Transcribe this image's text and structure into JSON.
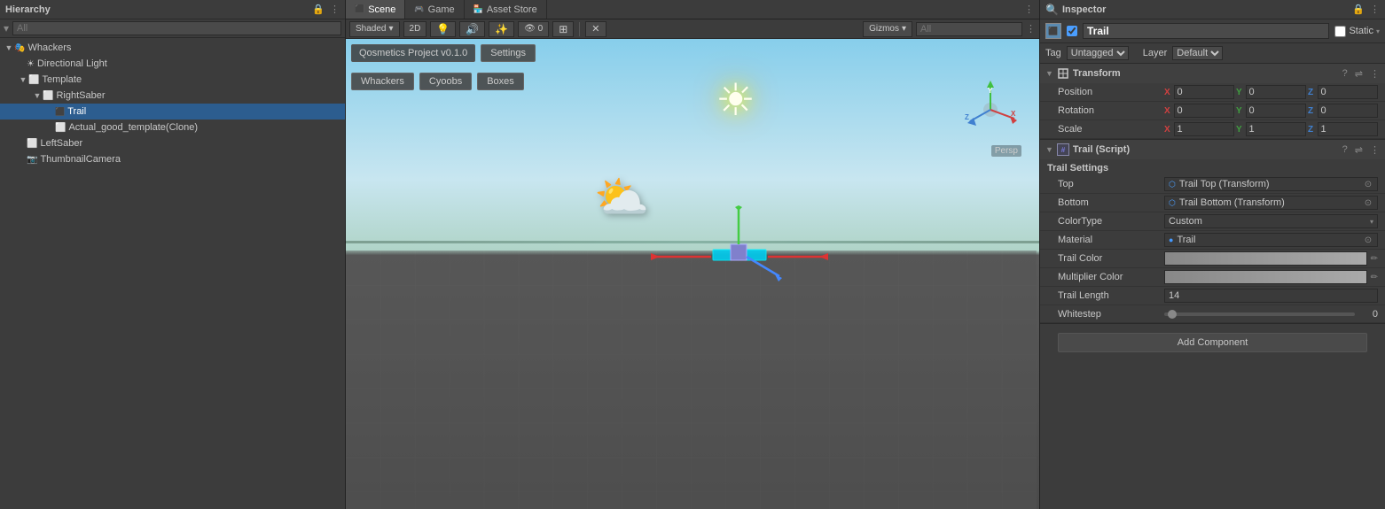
{
  "hierarchy": {
    "title": "Hierarchy",
    "search_placeholder": "All",
    "items": [
      {
        "id": "whackers",
        "label": "Whackers",
        "indent": 0,
        "arrow": "▼",
        "icon": "🎭",
        "selected": false
      },
      {
        "id": "directional-light",
        "label": "Directional Light",
        "indent": 1,
        "arrow": "",
        "icon": "☀",
        "selected": false
      },
      {
        "id": "template",
        "label": "Template",
        "indent": 1,
        "arrow": "▼",
        "icon": "⬜",
        "selected": false
      },
      {
        "id": "right-saber",
        "label": "RightSaber",
        "indent": 2,
        "arrow": "▼",
        "icon": "⬜",
        "selected": false
      },
      {
        "id": "trail",
        "label": "Trail",
        "indent": 3,
        "arrow": "",
        "icon": "⬛",
        "selected": true
      },
      {
        "id": "actual-good-template",
        "label": "Actual_good_template(Clone)",
        "indent": 3,
        "arrow": "",
        "icon": "⬜",
        "selected": false
      },
      {
        "id": "left-saber",
        "label": "LeftSaber",
        "indent": 1,
        "arrow": "",
        "icon": "⬜",
        "selected": false
      },
      {
        "id": "thumbnail-camera",
        "label": "ThumbnailCamera",
        "indent": 1,
        "arrow": "",
        "icon": "📷",
        "selected": false
      }
    ]
  },
  "scene_tabs": [
    {
      "id": "scene",
      "label": "Scene",
      "icon": "⬛",
      "active": true
    },
    {
      "id": "game",
      "label": "Game",
      "icon": "🎮",
      "active": false
    },
    {
      "id": "asset-store",
      "label": "Asset Store",
      "icon": "🏪",
      "active": false
    }
  ],
  "scene_toolbar": {
    "shaded_label": "Shaded",
    "twod_label": "2D",
    "gizmos_label": "Gizmos",
    "search_placeholder": "All"
  },
  "scene_overlay": {
    "version": "Qosmetics Project v0.1.0",
    "settings_btn": "Settings",
    "btn1": "Whackers",
    "btn2": "Cyoobs",
    "btn3": "Boxes"
  },
  "inspector": {
    "title": "Inspector",
    "object_name": "Trail",
    "static_label": "Static",
    "tag_label": "Tag",
    "tag_value": "Untagged",
    "layer_label": "Layer",
    "layer_value": "Default",
    "transform": {
      "title": "Transform",
      "position_label": "Position",
      "position": {
        "x": "0",
        "y": "0",
        "z": "0"
      },
      "rotation_label": "Rotation",
      "rotation": {
        "x": "0",
        "y": "0",
        "z": "0"
      },
      "scale_label": "Scale",
      "scale": {
        "x": "1",
        "y": "1",
        "z": "1"
      }
    },
    "trail_script": {
      "title": "Trail (Script)",
      "settings_header": "Trail Settings",
      "top_label": "Top",
      "top_value": "Trail Top (Transform)",
      "bottom_label": "Bottom",
      "bottom_value": "Trail Bottom (Transform)",
      "color_type_label": "ColorType",
      "color_type_value": "Custom",
      "material_label": "Material",
      "material_value": "Trail",
      "trail_color_label": "Trail Color",
      "multiplier_color_label": "Multiplier Color",
      "trail_length_label": "Trail Length",
      "trail_length_value": "14",
      "whitestep_label": "Whitestep",
      "whitestep_value": "0"
    },
    "add_component_label": "Add Component"
  },
  "colors": {
    "selected_bg": "#2c5d8f",
    "panel_bg": "#3c3c3c",
    "darker_bg": "#2a2a2a",
    "accent_blue": "#4a9eff",
    "sky_top": "#6aabdc",
    "sky_bottom": "#a8d4e0",
    "ground": "#4a4a4a"
  }
}
